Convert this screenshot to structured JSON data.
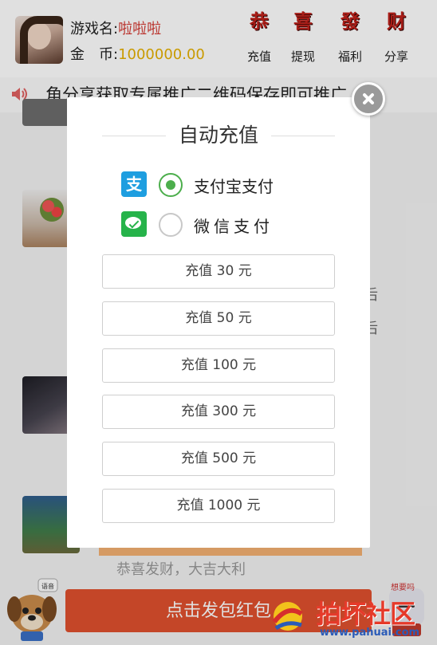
{
  "header": {
    "game_name_label": "游戏名:",
    "game_name_value": "啦啦啦",
    "coin_label": "金　币:",
    "coin_value": "1000000.00",
    "buttons": [
      {
        "glyph": "恭",
        "label": "充值"
      },
      {
        "glyph": "喜",
        "label": "提现"
      },
      {
        "glyph": "發",
        "label": "福利"
      },
      {
        "glyph": "财",
        "label": "分享"
      }
    ]
  },
  "marquee": {
    "text": "角分享获取专属推广二维码保存即可推广"
  },
  "feed": {
    "fragment_1": "后",
    "fragment_2": "后",
    "blessing": "恭喜发财，大吉大利"
  },
  "bottom": {
    "redbag_button": "点击发包红包",
    "mascot_bubble": "语音",
    "right_deco_text": "想要吗"
  },
  "modal": {
    "title": "自动充值",
    "payment_methods": [
      {
        "icon": "alipay-icon",
        "glyph": "支",
        "label": "支付宝支付",
        "selected": true
      },
      {
        "icon": "wechat-pay-icon",
        "label": "微信支付",
        "selected": false
      }
    ],
    "amounts": [
      "充值 30 元",
      "充值 50 元",
      "充值 100 元",
      "充值 300 元",
      "充值 500 元",
      "充值 1000 元"
    ]
  },
  "watermark": {
    "title": "拍坏社区",
    "url": "www.pahuai.com"
  },
  "colors": {
    "accent_red": "#d43b34",
    "coin_gold": "#e5b000",
    "radio_green": "#4cae4c",
    "alipay_blue": "#1e9ee0",
    "wechat_green": "#26b34a",
    "redbag_orange": "#e0502e"
  }
}
